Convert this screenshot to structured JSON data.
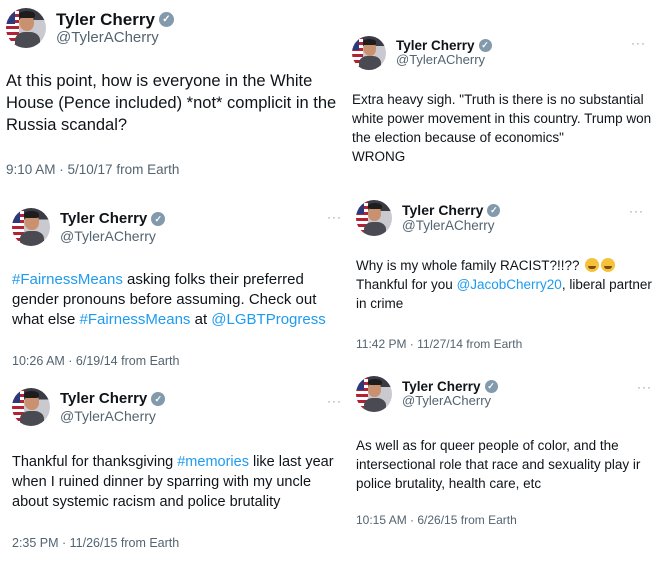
{
  "author": {
    "display_name": "Tyler Cherry",
    "handle": "@TylerACherry",
    "verified_icon": "verified-badge-icon",
    "more_icon": "more-options-icon"
  },
  "colors": {
    "link": "#1d9bf0",
    "meta": "#536471",
    "text": "#0f1419",
    "verified_badge": "#829aab"
  },
  "tweets": [
    {
      "text": "At this point, how is everyone in the White House (Pence included) *not* complicit in the Russia scandal?",
      "timestamp": "9:10 AM · 5/10/17 from Earth"
    },
    {
      "text": "Extra heavy sigh. \"Truth is there is no substantial white power movement in this country. Trump won the election because of economics\"\nWRONG",
      "timestamp": ""
    },
    {
      "hashtag1": "#FairnessMeans",
      "text1": " asking folks their preferred gender pronouns before assuming. Check out what else ",
      "hashtag2": "#FairnessMeans",
      "text2": " at ",
      "mention": "@LGBTProgress",
      "timestamp": "10:26 AM · 6/19/14 from Earth"
    },
    {
      "text1": "Why is my whole family RACIST?!!??",
      "emoji": "tears-of-joy-emoji",
      "text2": "\nThankful for you ",
      "mention": "@JacobCherry20",
      "text3": ", liberal partner in crime",
      "timestamp": "11:42 PM · 11/27/14 from Earth"
    },
    {
      "text1": "Thankful for thanksgiving ",
      "hashtag": "#memories",
      "text2": " like last year when I ruined dinner by sparring with my uncle about systemic racism and police brutality",
      "timestamp": "2:35 PM · 11/26/15 from Earth"
    },
    {
      "text": "As well as for queer people of color, and the intersectional role that race and sexuality play ir police brutality, health care, etc",
      "timestamp": "10:15 AM · 6/26/15 from Earth"
    }
  ]
}
